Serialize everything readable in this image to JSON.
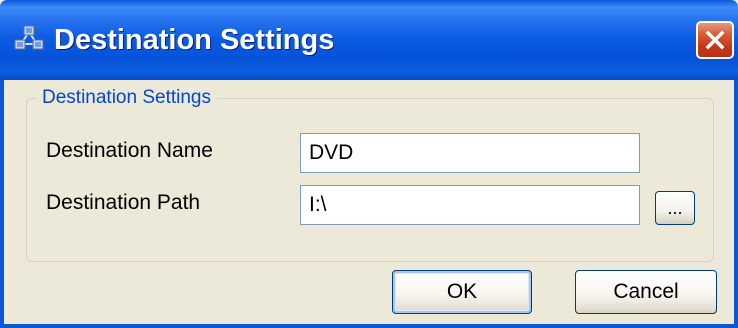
{
  "window": {
    "title": "Destination Settings",
    "icon": "network-nodes-icon",
    "close_icon": "close-x-icon",
    "colors": {
      "titlebar": "#0b5ce4",
      "close_button": "#d65a33",
      "dialog_background": "#ece9d8",
      "group_legend": "#0046d5"
    }
  },
  "group": {
    "legend": "Destination Settings",
    "name_label": "Destination Name",
    "name_value": "DVD",
    "path_label": "Destination Path",
    "path_value": "I:\\",
    "browse_label": "..."
  },
  "buttons": {
    "ok_label": "OK",
    "cancel_label": "Cancel"
  }
}
